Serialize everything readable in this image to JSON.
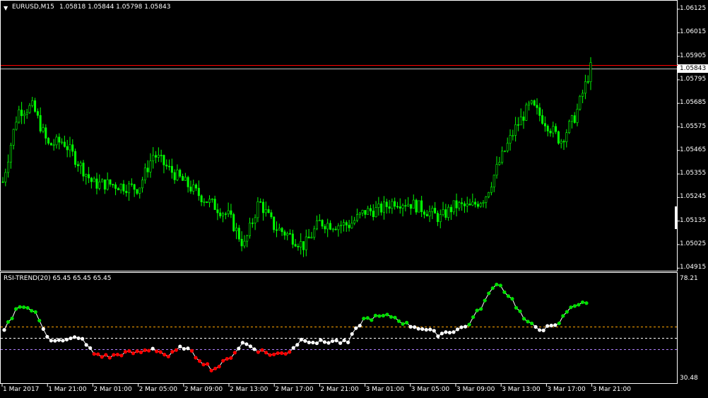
{
  "main": {
    "title": "EURUSD,M15",
    "ohlc": "1.05818 1.05844 1.05798 1.05843",
    "menu_icon": "triangle-down-icon",
    "price_axis_labels": [
      "1.06125",
      "1.06015",
      "1.05905",
      "1.05795",
      "1.05685",
      "1.05575",
      "1.05465",
      "1.05355",
      "1.05245",
      "1.05135",
      "1.05025",
      "1.04915"
    ],
    "current_price": "1.05843",
    "colors": {
      "candle": "#00ff00",
      "level_line": "#ff0000",
      "background": "#000000",
      "grid": "#ffffff"
    }
  },
  "indicator": {
    "title": "RSI-TREND(20) 65.45 65.45 65.45",
    "axis_max": "78.21",
    "axis_min": "30.48",
    "colors": {
      "up": "#00e000",
      "neutral": "#ffffff",
      "down": "#ff0000",
      "level_upper": "#ffa500",
      "level_mid": "#ffffff",
      "level_lower": "#b080ff"
    }
  },
  "time_axis_labels": [
    "1 Mar 2017",
    "1 Mar 21:00",
    "2 Mar 01:00",
    "2 Mar 05:00",
    "2 Mar 09:00",
    "2 Mar 13:00",
    "2 Mar 17:00",
    "2 Mar 21:00",
    "3 Mar 01:00",
    "3 Mar 05:00",
    "3 Mar 09:00",
    "3 Mar 13:00",
    "3 Mar 17:00",
    "3 Mar 21:00"
  ],
  "chart_data": [
    {
      "type": "line",
      "title": "EURUSD,M15",
      "ylim": [
        1.04915,
        1.06125
      ],
      "x": [
        "1 Mar 2017",
        "1 Mar 21:00",
        "2 Mar 01:00",
        "2 Mar 05:00",
        "2 Mar 09:00",
        "2 Mar 13:00",
        "2 Mar 17:00",
        "2 Mar 21:00",
        "3 Mar 01:00",
        "3 Mar 05:00",
        "3 Mar 09:00",
        "3 Mar 13:00",
        "3 Mar 17:00",
        "3 Mar 21:00"
      ],
      "series": [
        {
          "values": [
            1.0532,
            1.0565,
            1.0567,
            1.0549,
            1.0551,
            1.0541,
            1.0531,
            1.0531,
            1.053,
            1.0529,
            1.0545,
            1.0538,
            1.0532,
            1.0526,
            1.0521,
            1.0516,
            1.0502,
            1.0523,
            1.0511,
            1.0507,
            1.0502,
            1.0513,
            1.0512,
            1.0512,
            1.0518,
            1.0519,
            1.0523,
            1.0522,
            1.0519,
            1.0515,
            1.0521,
            1.052,
            1.0525,
            1.0542,
            1.0557,
            1.0568,
            1.056,
            1.0551,
            1.0563,
            1.0585
          ]
        }
      ]
    },
    {
      "type": "scatter",
      "title": "RSI-TREND(20)",
      "ylim": [
        30.48,
        78.21
      ],
      "series": [
        {
          "values": [
            53.2,
            65.8,
            62.6,
            49.5,
            47.9,
            50.5,
            42.3,
            40.6,
            42.5,
            42.7,
            44.9,
            40.9,
            45.8,
            40.0,
            34.5,
            39.6,
            47.5,
            44.0,
            41.7,
            42.9,
            49.4,
            47.6,
            48.3,
            47.3,
            58.5,
            59.8,
            60.2,
            56.1,
            54.4,
            51.6,
            53.1,
            55.4,
            65.2,
            76.6,
            68.4,
            56.8,
            54.1,
            55.3,
            65.5,
            66.2
          ]
        }
      ]
    }
  ]
}
